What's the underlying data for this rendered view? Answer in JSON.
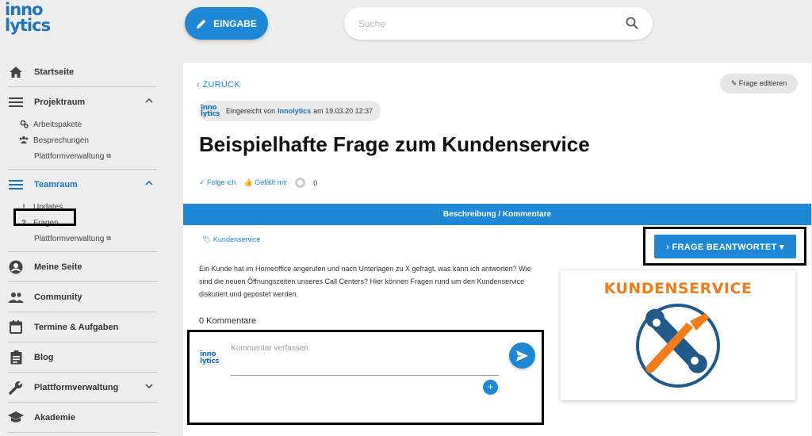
{
  "brand": {
    "logo_line1": "inno",
    "logo_line2": "lytics"
  },
  "nav": {
    "startseite": "Startseite",
    "projektraum": "Projektraum",
    "arbeitspakete": "Arbeitspakete",
    "besprechungen": "Besprechungen",
    "plattform1": "Plattformverwaltung",
    "teamraum": "Teamraum",
    "updates": "Updates",
    "fragen": "Fragen",
    "plattform2": "Plattformverwaltung",
    "meine_seite": "Meine Seite",
    "community": "Community",
    "termine": "Termine & Aufgaben",
    "blog": "Blog",
    "plattformverwaltung": "Plattformverwaltung",
    "akademie": "Akademie",
    "ext_glyph": "⧉",
    "updates_glyph": "!",
    "fragen_glyph": "?"
  },
  "topbar": {
    "eingabe": "EINGABE",
    "search_placeholder": "Suche"
  },
  "question": {
    "back": "‹  ZURÜCK",
    "edit": "✎ Frage editieren",
    "submitted_prefix": "Eingereicht von",
    "submitted_by": "Innolytics",
    "submitted_date": "am 19.03.20 12:37",
    "title": "Beispielhafte Frage zum Kundenservice",
    "follow": "✓ Folge ich",
    "like": "👍 Gefällt mir",
    "like_count": "0",
    "tab_bar": "Beschreibung / Kommentare",
    "tag": "🏷 Kundenservice",
    "answered_button": "›  FRAGE BEANTWORTET ▾",
    "description": "Ein Kunde hat im Homeoffice angerufen und nach Unterlagen zu X gefragt, was kann ich antworten? Wie sind die neuen Öffnungszeiten unseres Call Centers? Hier können Fragen rund um den Kundenservice diskutiert und gepostet werden.",
    "comments_count": "0 Kommentare",
    "comment_placeholder": "Kommentar verfassen",
    "plus": "+",
    "image_title": "KUNDENSERVICE"
  },
  "colors": {
    "accent": "#1e88d6",
    "brand": "#1e73be",
    "orange": "#f07c1a"
  }
}
